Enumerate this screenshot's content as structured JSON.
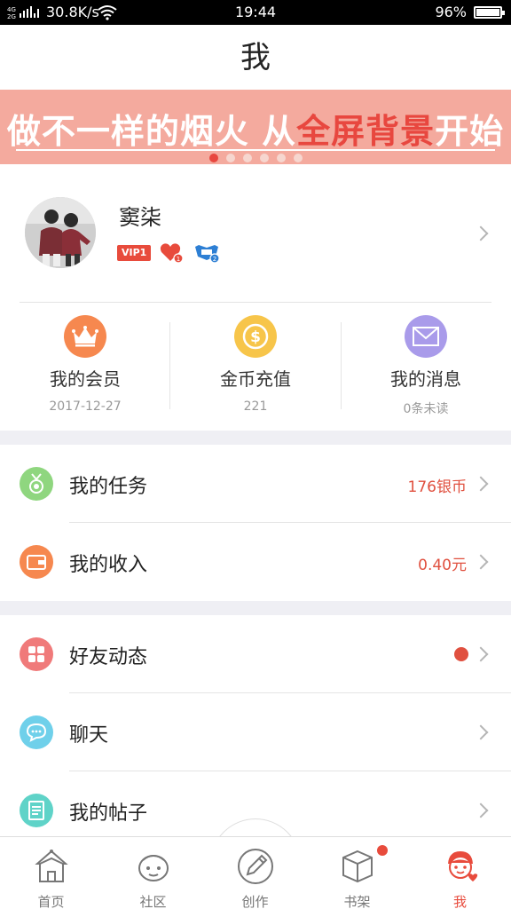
{
  "status_bar": {
    "network": "4G 2G",
    "speed": "30.8K/s",
    "time": "19:44",
    "battery": "96%"
  },
  "header": {
    "title": "我"
  },
  "banner": {
    "text_part1": "做不一样的烟火  从",
    "text_highlight": "全屏背景",
    "text_part2": "开始",
    "page_count": 6,
    "active_index": 0
  },
  "profile": {
    "username": "窦柒",
    "vip_label": "VIP1",
    "heart_level": "1",
    "badge_level": "2"
  },
  "stats": [
    {
      "label": "我的会员",
      "sub": "2017-12-27",
      "icon": "crown-icon",
      "color": "#f6884f"
    },
    {
      "label": "金币充值",
      "sub": "221",
      "icon": "coin-icon",
      "color": "#f7c54a"
    },
    {
      "label": "我的消息",
      "sub": "0条未读",
      "icon": "mail-icon",
      "color": "#a99bea"
    }
  ],
  "menu_group1": [
    {
      "label": "我的任务",
      "value": "176银币",
      "icon": "medal-icon",
      "color": "#8fd67f"
    },
    {
      "label": "我的收入",
      "value": "0.40元",
      "icon": "wallet-icon",
      "color": "#f6884f"
    }
  ],
  "menu_group2": [
    {
      "label": "好友动态",
      "has_dot": true,
      "icon": "grid-icon",
      "color": "#f07a7a"
    },
    {
      "label": "聊天",
      "icon": "chat-icon",
      "color": "#6fd0ea"
    },
    {
      "label": "我的帖子",
      "icon": "document-icon",
      "color": "#5fd3c8"
    }
  ],
  "tabs": [
    {
      "label": "首页",
      "icon": "home-tent-icon"
    },
    {
      "label": "社区",
      "icon": "community-face-icon"
    },
    {
      "label": "创作",
      "icon": "pencil-icon"
    },
    {
      "label": "书架",
      "icon": "bookshelf-box-icon"
    },
    {
      "label": "我",
      "icon": "me-avatar-icon",
      "active": true
    }
  ],
  "colors": {
    "accent": "#e84b3c",
    "banner_bg": "#f4aa9e",
    "separator": "#efeff4"
  }
}
